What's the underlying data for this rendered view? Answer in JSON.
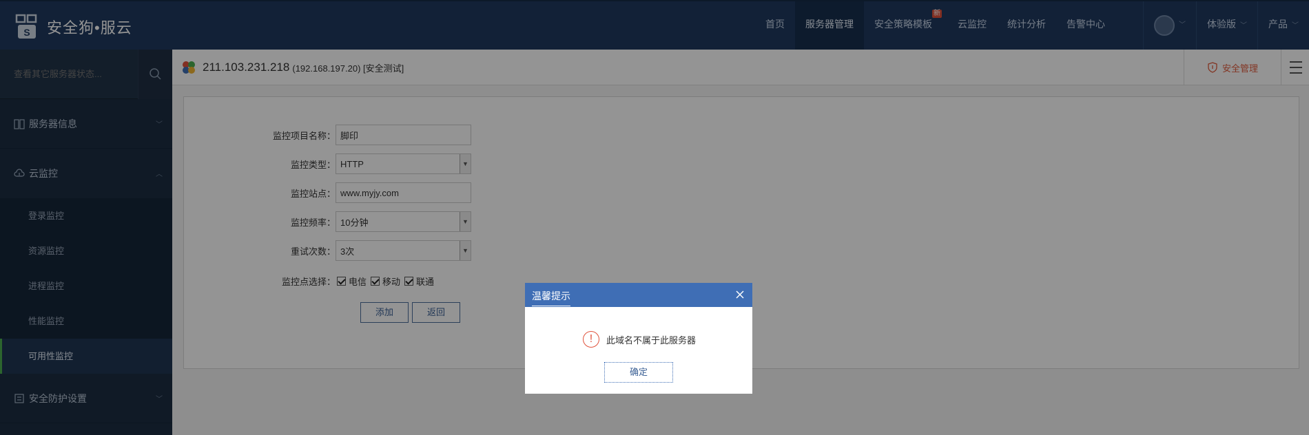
{
  "app": {
    "logo_text": "安全狗•服云"
  },
  "topnav": {
    "items": [
      {
        "label": "首页"
      },
      {
        "label": "服务器管理"
      },
      {
        "label": "安全策略模板",
        "badge": "新"
      },
      {
        "label": "云监控"
      },
      {
        "label": "统计分析"
      },
      {
        "label": "告警中心"
      }
    ],
    "edition": "体验版",
    "products": "产品"
  },
  "sidebar": {
    "search_placeholder": "查看其它服务器状态...",
    "sections": [
      {
        "label": "服务器信息"
      },
      {
        "label": "云监控"
      },
      {
        "label": "安全防护设置"
      }
    ],
    "sub_items": [
      {
        "label": "登录监控"
      },
      {
        "label": "资源监控"
      },
      {
        "label": "进程监控"
      },
      {
        "label": "性能监控"
      },
      {
        "label": "可用性监控"
      }
    ]
  },
  "server": {
    "ip": "211.103.231.218",
    "sub": "(192.168.197.20) [安全测试]",
    "security_button": "安全管理"
  },
  "form": {
    "name_label": "监控项目名称：",
    "name_value": "脚印",
    "type_label": "监控类型：",
    "type_value": "HTTP",
    "site_label": "监控站点：",
    "site_value": "www.myjy.com",
    "freq_label": "监控频率：",
    "freq_value": "10分钟",
    "retry_label": "重试次数：",
    "retry_value": "3次",
    "points_label": "监控点选择：",
    "points": [
      {
        "label": "电信"
      },
      {
        "label": "移动"
      },
      {
        "label": "联通"
      }
    ],
    "add_button": "添加",
    "back_button": "返回"
  },
  "modal": {
    "title": "温馨提示",
    "message": "此域名不属于此服务器",
    "ok_button": "确定"
  },
  "colors": {
    "topbar": "#1f3a5f",
    "sidebar": "#1c2d42",
    "modal_header": "#3f6eb5",
    "accent_red": "#e05a3c",
    "active_green": "#4caf50"
  }
}
